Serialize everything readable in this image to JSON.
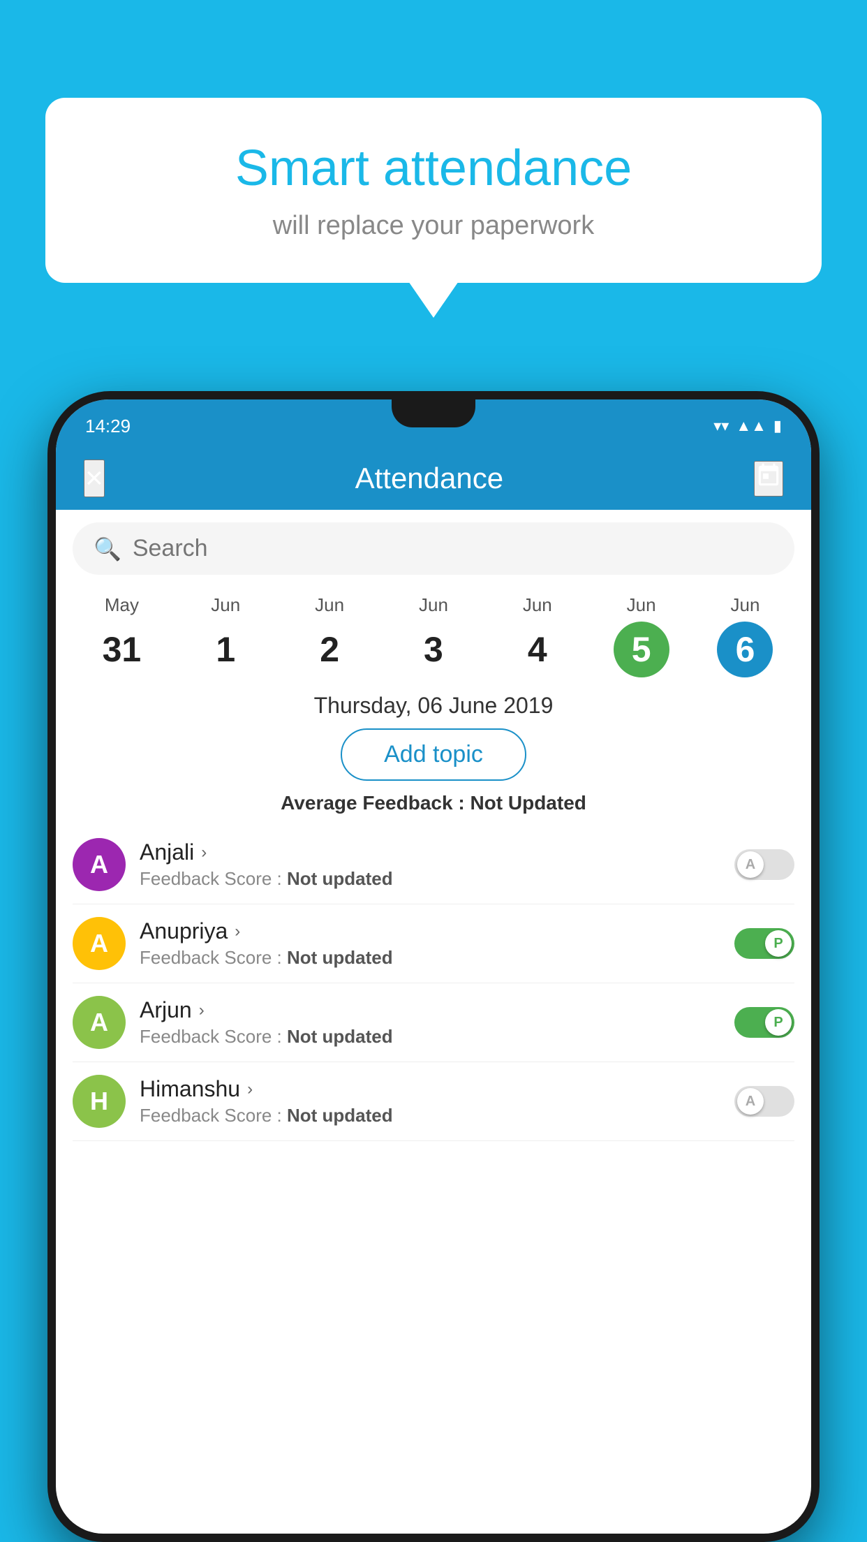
{
  "background": {
    "color": "#1ab8e8"
  },
  "bubble": {
    "title": "Smart attendance",
    "subtitle": "will replace your paperwork"
  },
  "status_bar": {
    "time": "14:29"
  },
  "app_bar": {
    "title": "Attendance",
    "close_label": "×",
    "calendar_label": "📅"
  },
  "search": {
    "placeholder": "Search"
  },
  "calendar": {
    "days": [
      {
        "month": "May",
        "date": "31",
        "style": "normal"
      },
      {
        "month": "Jun",
        "date": "1",
        "style": "normal"
      },
      {
        "month": "Jun",
        "date": "2",
        "style": "normal"
      },
      {
        "month": "Jun",
        "date": "3",
        "style": "normal"
      },
      {
        "month": "Jun",
        "date": "4",
        "style": "normal"
      },
      {
        "month": "Jun",
        "date": "5",
        "style": "today"
      },
      {
        "month": "Jun",
        "date": "6",
        "style": "selected"
      }
    ]
  },
  "selected_date": "Thursday, 06 June 2019",
  "add_topic_label": "Add topic",
  "average_feedback": {
    "label": "Average Feedback : ",
    "value": "Not Updated"
  },
  "students": [
    {
      "name": "Anjali",
      "initial": "A",
      "avatar_color": "#9C27B0",
      "feedback_label": "Feedback Score : ",
      "feedback_value": "Not updated",
      "toggle": "off",
      "toggle_letter": "A"
    },
    {
      "name": "Anupriya",
      "initial": "A",
      "avatar_color": "#FFC107",
      "feedback_label": "Feedback Score : ",
      "feedback_value": "Not updated",
      "toggle": "on",
      "toggle_letter": "P"
    },
    {
      "name": "Arjun",
      "initial": "A",
      "avatar_color": "#8BC34A",
      "feedback_label": "Feedback Score : ",
      "feedback_value": "Not updated",
      "toggle": "on",
      "toggle_letter": "P"
    },
    {
      "name": "Himanshu",
      "initial": "H",
      "avatar_color": "#8BC34A",
      "feedback_label": "Feedback Score : ",
      "feedback_value": "Not updated",
      "toggle": "off",
      "toggle_letter": "A"
    }
  ]
}
